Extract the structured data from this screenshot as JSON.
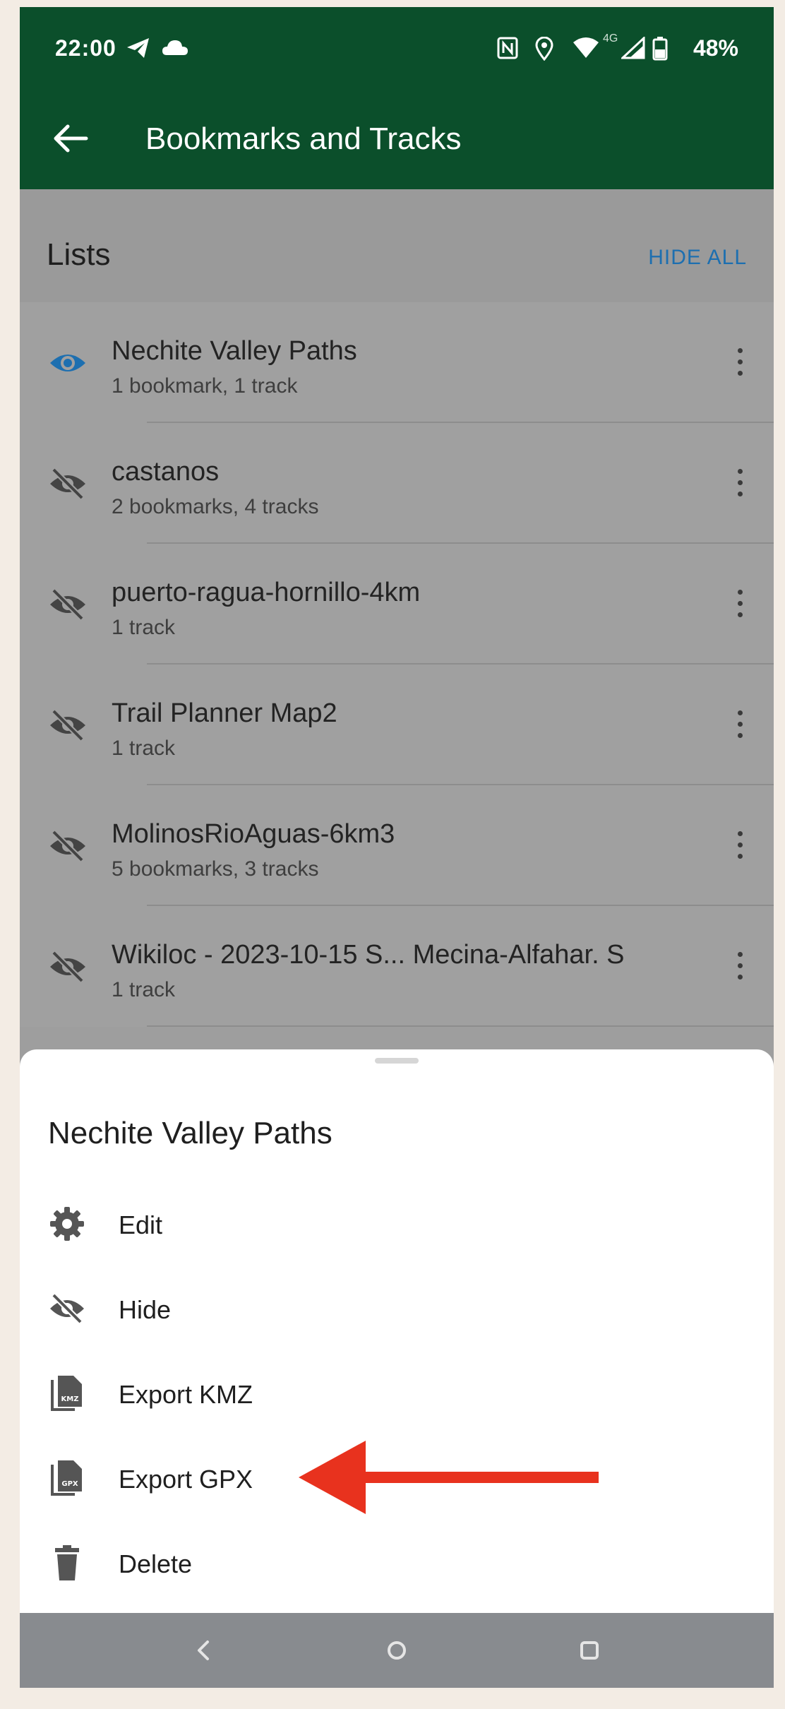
{
  "status_bar": {
    "time": "22:00",
    "network": "4G",
    "battery": "48%"
  },
  "app_bar": {
    "title": "Bookmarks and Tracks"
  },
  "lists": {
    "title": "Lists",
    "hide_all_label": "HIDE ALL",
    "items": [
      {
        "title": "Nechite Valley Paths",
        "subtitle": "1 bookmark, 1 track",
        "visible": true
      },
      {
        "title": "castanos",
        "subtitle": "2 bookmarks, 4 tracks",
        "visible": false
      },
      {
        "title": "puerto-ragua-hornillo-4km",
        "subtitle": "1 track",
        "visible": false
      },
      {
        "title": "Trail Planner Map2",
        "subtitle": "1 track",
        "visible": false
      },
      {
        "title": "MolinosRioAguas-6km3",
        "subtitle": "5 bookmarks, 3 tracks",
        "visible": false
      },
      {
        "title": "Wikiloc - 2023-10-15 S...   Mecina-Alfahar. S",
        "subtitle": "1 track",
        "visible": false
      }
    ]
  },
  "sheet": {
    "title": "Nechite Valley Paths",
    "menu": [
      {
        "label": "Edit",
        "icon": "gear-icon"
      },
      {
        "label": "Hide",
        "icon": "eye-off-icon"
      },
      {
        "label": "Export KMZ",
        "icon": "kmz-file-icon",
        "badge": "KMZ"
      },
      {
        "label": "Export GPX",
        "icon": "gpx-file-icon",
        "badge": "GPX"
      },
      {
        "label": "Delete",
        "icon": "trash-icon"
      }
    ]
  },
  "colors": {
    "app_bar": "#0b4f2b",
    "accent": "#1d6fb0",
    "annotation_arrow": "#e8321e"
  }
}
